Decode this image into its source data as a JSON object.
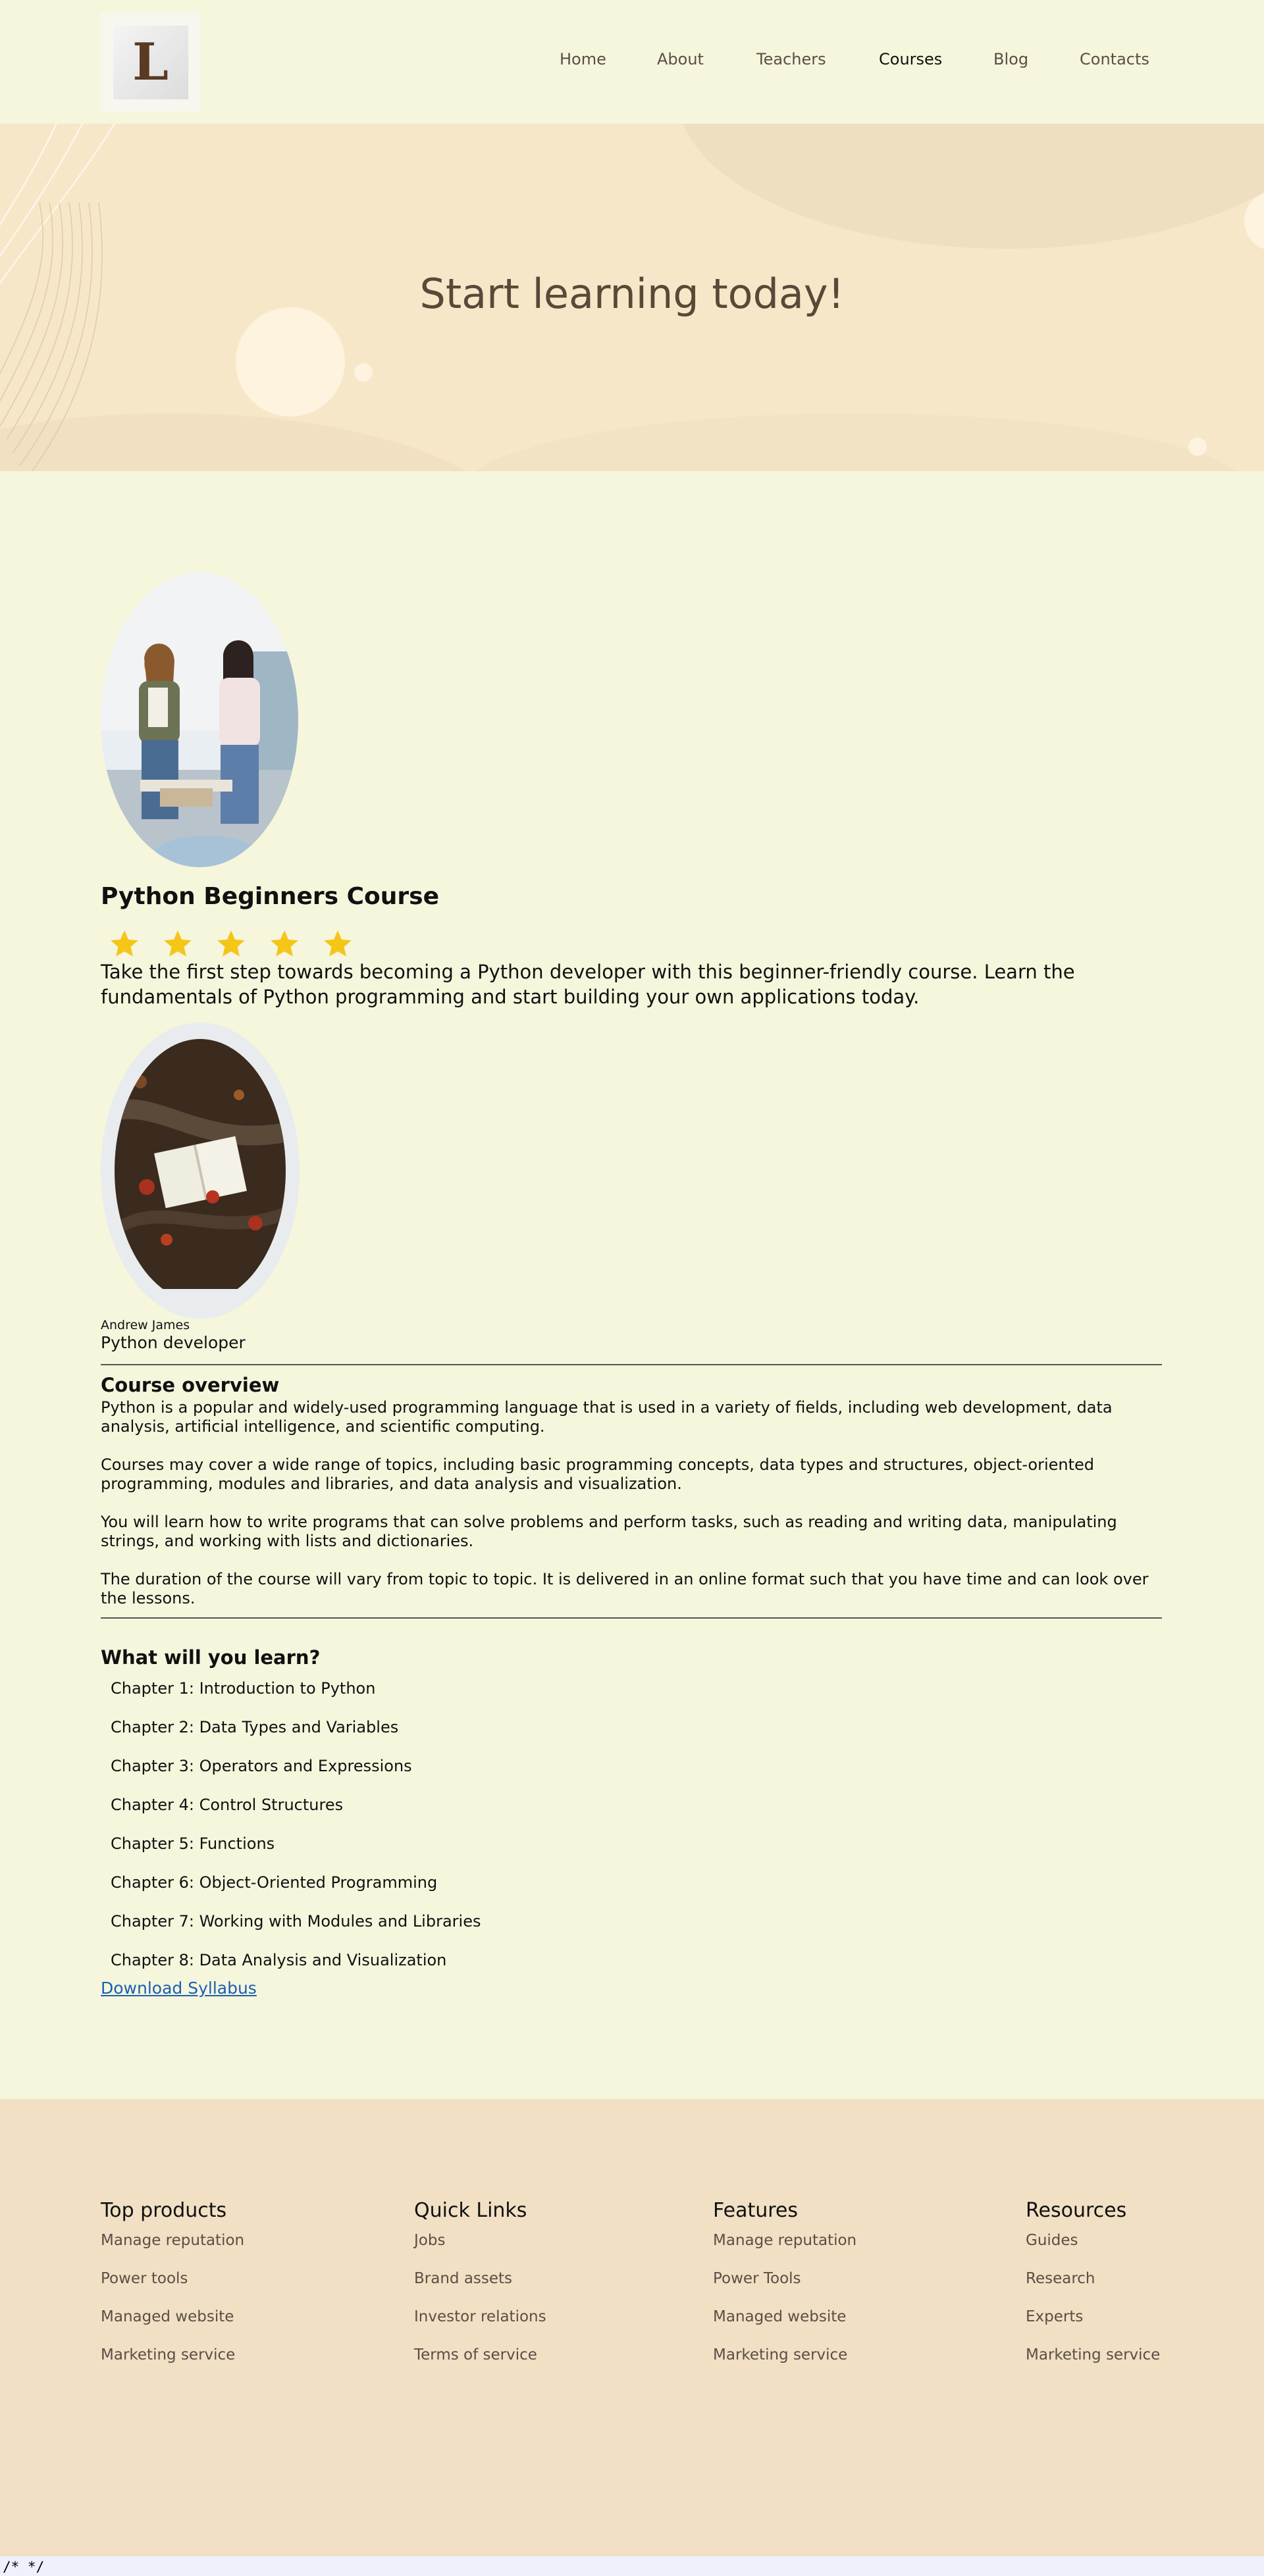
{
  "header": {
    "logo_letter": "L",
    "nav": [
      {
        "label": "Home",
        "active": false
      },
      {
        "label": "About",
        "active": false
      },
      {
        "label": "Teachers",
        "active": false
      },
      {
        "label": "Courses",
        "active": true
      },
      {
        "label": "Blog",
        "active": false
      },
      {
        "label": "Contacts",
        "active": false
      }
    ]
  },
  "hero": {
    "title": "Start learning today!"
  },
  "course": {
    "title": "Python Beginners Course",
    "rating": 5,
    "rating_max": 5,
    "description": "Take the first step towards becoming a Python developer with this beginner-friendly course. Learn the fundamentals of Python programming and start building your own applications today.",
    "teacher": {
      "name": "Andrew James",
      "role": "Python developer"
    },
    "overview": {
      "title": "Course overview",
      "paragraphs": [
        "Python is a popular and widely-used programming language that is used in a variety of fields, including web development, data analysis, artificial intelligence, and scientific computing.",
        "Courses may cover a wide range of topics, including basic programming concepts, data types and structures, object-oriented programming, modules and libraries, and data analysis and visualization.",
        "You will learn how to write programs that can solve problems and perform tasks, such as reading and writing data, manipulating strings, and working with lists and dictionaries.",
        "The duration of the course will vary from topic to topic. It is delivered in an online format such that you have time and can look over the lessons."
      ]
    },
    "learn": {
      "title": "What will you learn?",
      "chapters": [
        "Chapter 1: Introduction to Python",
        "Chapter 2: Data Types and Variables",
        "Chapter 3: Operators and Expressions",
        "Chapter 4: Control Structures",
        "Chapter 5: Functions",
        "Chapter 6: Object-Oriented Programming",
        "Chapter 7: Working with Modules and Libraries",
        "Chapter 8: Data Analysis and Visualization"
      ]
    },
    "download_label": "Download Syllabus"
  },
  "footer": {
    "columns": [
      {
        "title": "Top products",
        "links": [
          "Manage reputation",
          "Power tools",
          "Managed website",
          "Marketing service"
        ]
      },
      {
        "title": "Quick Links",
        "links": [
          "Jobs",
          "Brand assets",
          "Investor relations",
          "Terms of service"
        ]
      },
      {
        "title": "Features",
        "links": [
          "Manage reputation",
          "Power Tools",
          "Managed website",
          "Marketing service"
        ]
      },
      {
        "title": "Resources",
        "links": [
          "Guides",
          "Research",
          "Experts",
          "Marketing service"
        ]
      }
    ]
  },
  "code_comment": "/* */",
  "colors": {
    "page_bg": "#f5f6dc",
    "hero_bg": "#f6e7c8",
    "footer_bg": "#f1e0c4",
    "star": "#f5c518",
    "link": "#1a5fb4"
  }
}
